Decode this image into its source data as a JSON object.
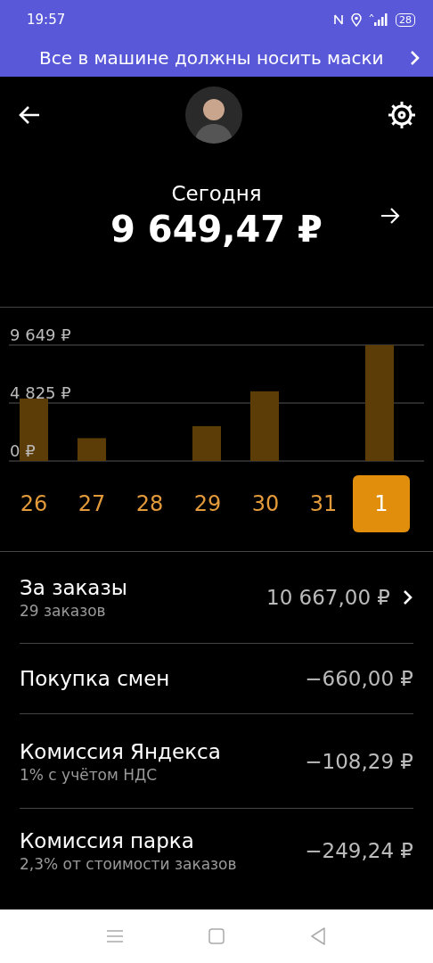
{
  "status_bar": {
    "time": "19:57",
    "battery": "28"
  },
  "banner": {
    "text": "Все в машине должны носить маски"
  },
  "summary": {
    "label": "Сегодня",
    "amount": "9 649,47 ₽"
  },
  "chart": {
    "chart_data": {
      "type": "bar",
      "categories": [
        "26",
        "27",
        "28",
        "29",
        "30",
        "31",
        "1"
      ],
      "values": [
        5200,
        1900,
        0,
        2900,
        5800,
        0,
        9649
      ],
      "ylim": [
        0,
        9649
      ],
      "yticks": [
        {
          "value": 0,
          "label": "0 ₽"
        },
        {
          "value": 4825,
          "label": "4 825 ₽"
        },
        {
          "value": 9649,
          "label": "9 649 ₽"
        }
      ]
    }
  },
  "days": [
    {
      "selected": false
    },
    {
      "selected": false
    },
    {
      "selected": false
    },
    {
      "selected": false
    },
    {
      "selected": false
    },
    {
      "selected": false
    },
    {
      "selected": true
    }
  ],
  "rows": [
    {
      "kind": "link",
      "title": "За заказы",
      "subtitle": "29 заказов",
      "value": "10 667,00 ₽"
    },
    {
      "kind": "plain",
      "title": "Покупка смен",
      "value": "−660,00 ₽"
    },
    {
      "kind": "plain",
      "title": "Комиссия Яндекса",
      "subtitle": "1% с учётом НДС",
      "value": "−108,29 ₽"
    },
    {
      "kind": "plain",
      "title": "Комиссия парка",
      "subtitle": "2,3% от стоимости заказов",
      "value": "−249,24 ₽"
    }
  ]
}
